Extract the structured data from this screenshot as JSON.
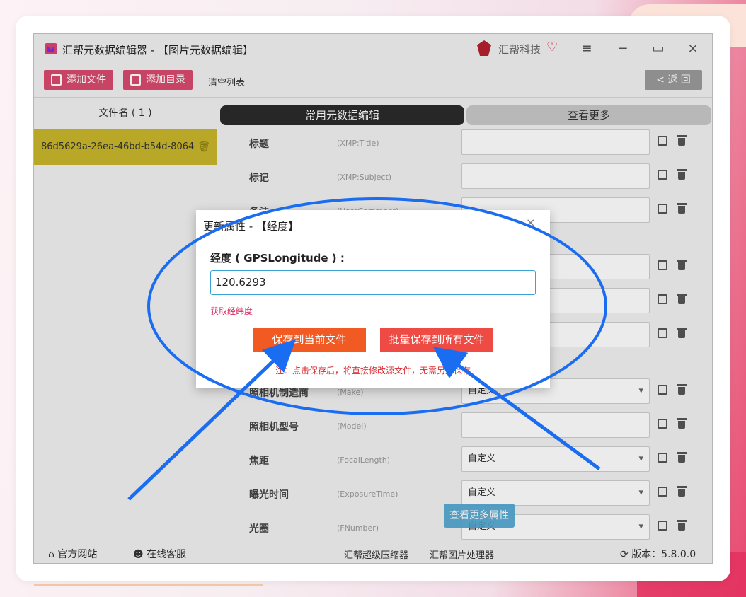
{
  "window": {
    "title": "汇帮元数据编辑器 - 【图片元数据编辑】",
    "brand": "汇帮科技",
    "menu_icon": "≡",
    "minimize_icon": "−",
    "maximize_icon": "▭",
    "close_icon": "×"
  },
  "toolbar": {
    "add_file": "添加文件",
    "add_folder": "添加目录",
    "clear_list": "清空列表",
    "back": "< 返 回"
  },
  "file_list": {
    "header": "文件名 ( 1 )",
    "items": [
      {
        "name": "86d5629a-26ea-46bd-b54d-8064"
      }
    ]
  },
  "tabs": {
    "common": "常用元数据编辑",
    "more": "查看更多"
  },
  "fields": [
    {
      "label": "标题",
      "key": "(XMP:Title)",
      "value": ""
    },
    {
      "label": "标记",
      "key": "(XMP:Subject)",
      "value": ""
    },
    {
      "label": "备注",
      "key": "(UserComment)",
      "value": ""
    },
    {
      "label": "照相机制造商",
      "key": "(Make)",
      "value": "自定义"
    },
    {
      "label": "照相机型号",
      "key": "(Model)",
      "value": ""
    },
    {
      "label": "焦距",
      "key": "(FocalLength)",
      "value": "自定义"
    },
    {
      "label": "曝光时间",
      "key": "(ExposureTime)",
      "value": "自定义"
    },
    {
      "label": "光圈",
      "key": "(FNumber)",
      "value": "自定义"
    }
  ],
  "more_attributes": "查看更多属性",
  "statusbar": {
    "website": "官方网站",
    "service": "在线客服",
    "compressor": "汇帮超级压缩器",
    "image_tool": "汇帮图片处理器",
    "version": "版本：5.8.0.0"
  },
  "dialog": {
    "title": "更新属性 - 【经度】",
    "close_icon": "×",
    "field_label": "经度 ( GPSLongitude ) :",
    "value": "120.6293",
    "get_coords_link": "获取经纬度",
    "save_current": "保存到当前文件",
    "save_all": "批量保存到所有文件",
    "note": "注：点击保存后，将直接修改源文件，无需另外保存"
  },
  "colors": {
    "accent": "#d94a6e",
    "file_selected": "#c9b72b",
    "annotation": "#1a6cf0",
    "save_btn": "#f15a22",
    "batch_btn": "#ef4b45"
  }
}
